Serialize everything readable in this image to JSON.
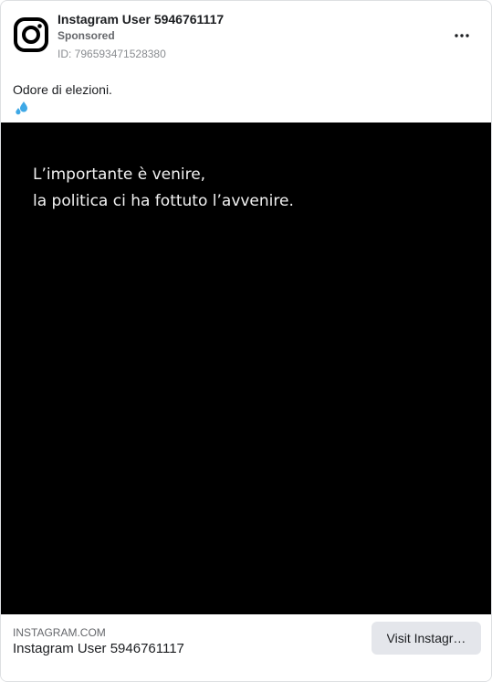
{
  "header": {
    "profile_name": "Instagram User 5946761117",
    "sponsored_label": "Sponsored",
    "ad_id": "ID: 796593471528380",
    "avatar_icon": "instagram-logo-icon",
    "more_icon": "more-horizontal-icon"
  },
  "post": {
    "caption": "Odore di elezioni.",
    "emoji_icon": "sweat-droplets-icon",
    "emoji_color": "#3ea8e6"
  },
  "media": {
    "background": "#000000",
    "lines": [
      "L’importante è venire,",
      "la politica ci ha fottuto l’avvenire."
    ]
  },
  "footer": {
    "domain": "INSTAGRAM.COM",
    "title": "Instagram User 5946761117",
    "cta_label": "Visit Instagr…"
  }
}
